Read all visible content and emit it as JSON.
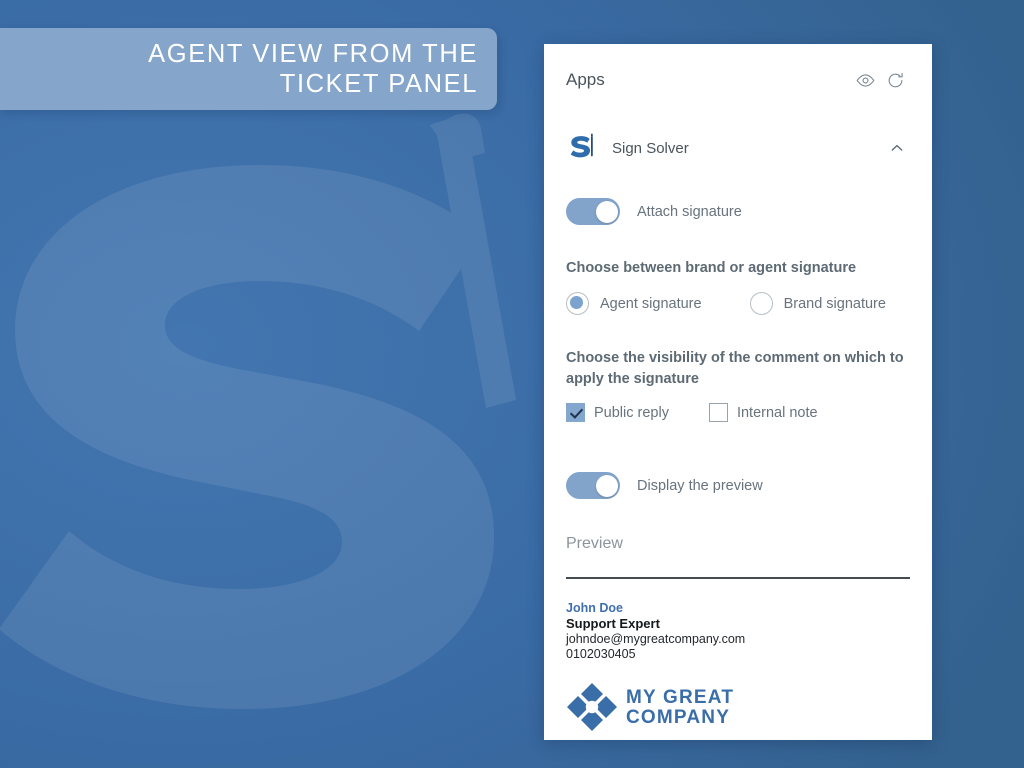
{
  "banner": {
    "text": "AGENT VIEW FROM THE\nTICKET PANEL"
  },
  "panel": {
    "header": {
      "title": "Apps",
      "preview_icon": "eye-icon",
      "refresh_icon": "refresh-icon"
    },
    "app": {
      "name": "Sign Solver",
      "logo_icon": "sign-solver-logo-icon",
      "collapse_icon": "chevron-up-icon"
    },
    "attach_signature": {
      "label": "Attach signature",
      "state": "on"
    },
    "signature_source": {
      "heading": "Choose between brand or agent signature",
      "options": [
        {
          "label": "Agent signature",
          "selected": true
        },
        {
          "label": "Brand signature",
          "selected": false
        }
      ]
    },
    "comment_visibility": {
      "heading": "Choose the visibility of the comment on which to apply the signature",
      "options": [
        {
          "label": "Public reply",
          "checked": true
        },
        {
          "label": "Internal note",
          "checked": false
        }
      ]
    },
    "display_preview": {
      "label": "Display the preview",
      "state": "on"
    },
    "preview": {
      "title": "Preview",
      "signature": {
        "name": "John Doe",
        "role": "Support Expert",
        "email": "johndoe@mygreatcompany.com",
        "phone": "0102030405"
      },
      "company_logo": {
        "line1": "MY GREAT",
        "line2": "COMPANY",
        "mark_icon": "diamond-cluster-logo-icon"
      }
    }
  },
  "colors": {
    "background": "#3a6ba5",
    "banner": "#85a6ca",
    "accent": "#7ba3cd",
    "brand_blue": "#3f6fad",
    "panel": "#ffffff"
  }
}
